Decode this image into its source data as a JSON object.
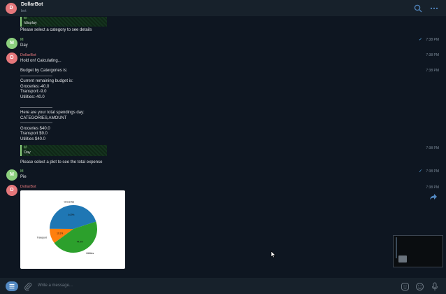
{
  "header": {
    "avatar_letter": "D",
    "title": "DollarBot",
    "subtitle": "bot"
  },
  "messages": {
    "top_reply_name": "M",
    "top_reply_text": "/display",
    "select_category": "Please select a category to see details",
    "m1_sender": "M",
    "m1_text": "Day",
    "m1_time": "7:38 PM",
    "d1_sender": "DollarBot",
    "d1_text": "Hold on! Calculating...",
    "d1_time": "7:38 PM",
    "budget_text": "Budget by Catergories is:\n-----------------------\nCurrent remaining budget is:\nGroceries:-40.0\nTransport:-9.0\nUtilities:-40.0\n\n-----------------------\nHere are your total spendings day:\nCATEGORIES,AMOUNT\n-----------------------\nGroceries $40.0\nTransport $9.0\nUtilities $40.0",
    "budget_time": "7:38 PM",
    "reply2_name": "M",
    "reply2_text": "Day",
    "reply2_time": "7:38 PM",
    "select_plot": "Please select a plot to see the total expense",
    "m2_sender": "M",
    "m2_text": "Pie",
    "m2_time": "7:38 PM",
    "d2_sender": "DollarBot",
    "d2_time": "7:38 PM",
    "avatar_m": "M",
    "avatar_d": "D"
  },
  "chart_data": {
    "type": "pie",
    "categories": [
      "Groceries",
      "Transport",
      "Utilities"
    ],
    "values": [
      40.0,
      9.0,
      40.0
    ],
    "percent_labels": [
      "44.9%",
      "10.1%",
      "44.9%"
    ],
    "colors": [
      "#1f77b4",
      "#ff7f0e",
      "#2ca02c"
    ]
  },
  "composer": {
    "placeholder": "Write a message..."
  },
  "colors": {
    "bg": "#0e1621",
    "panel": "#17212b",
    "accent": "#5288c1",
    "bot_name": "#e5777b",
    "user_name": "#8ccf7e"
  },
  "icons": [
    "search-icon",
    "more-icon",
    "menu-icon",
    "attach-icon",
    "emoji-icon",
    "sticker-icon",
    "microphone-icon",
    "forward-icon",
    "check-icon"
  ]
}
